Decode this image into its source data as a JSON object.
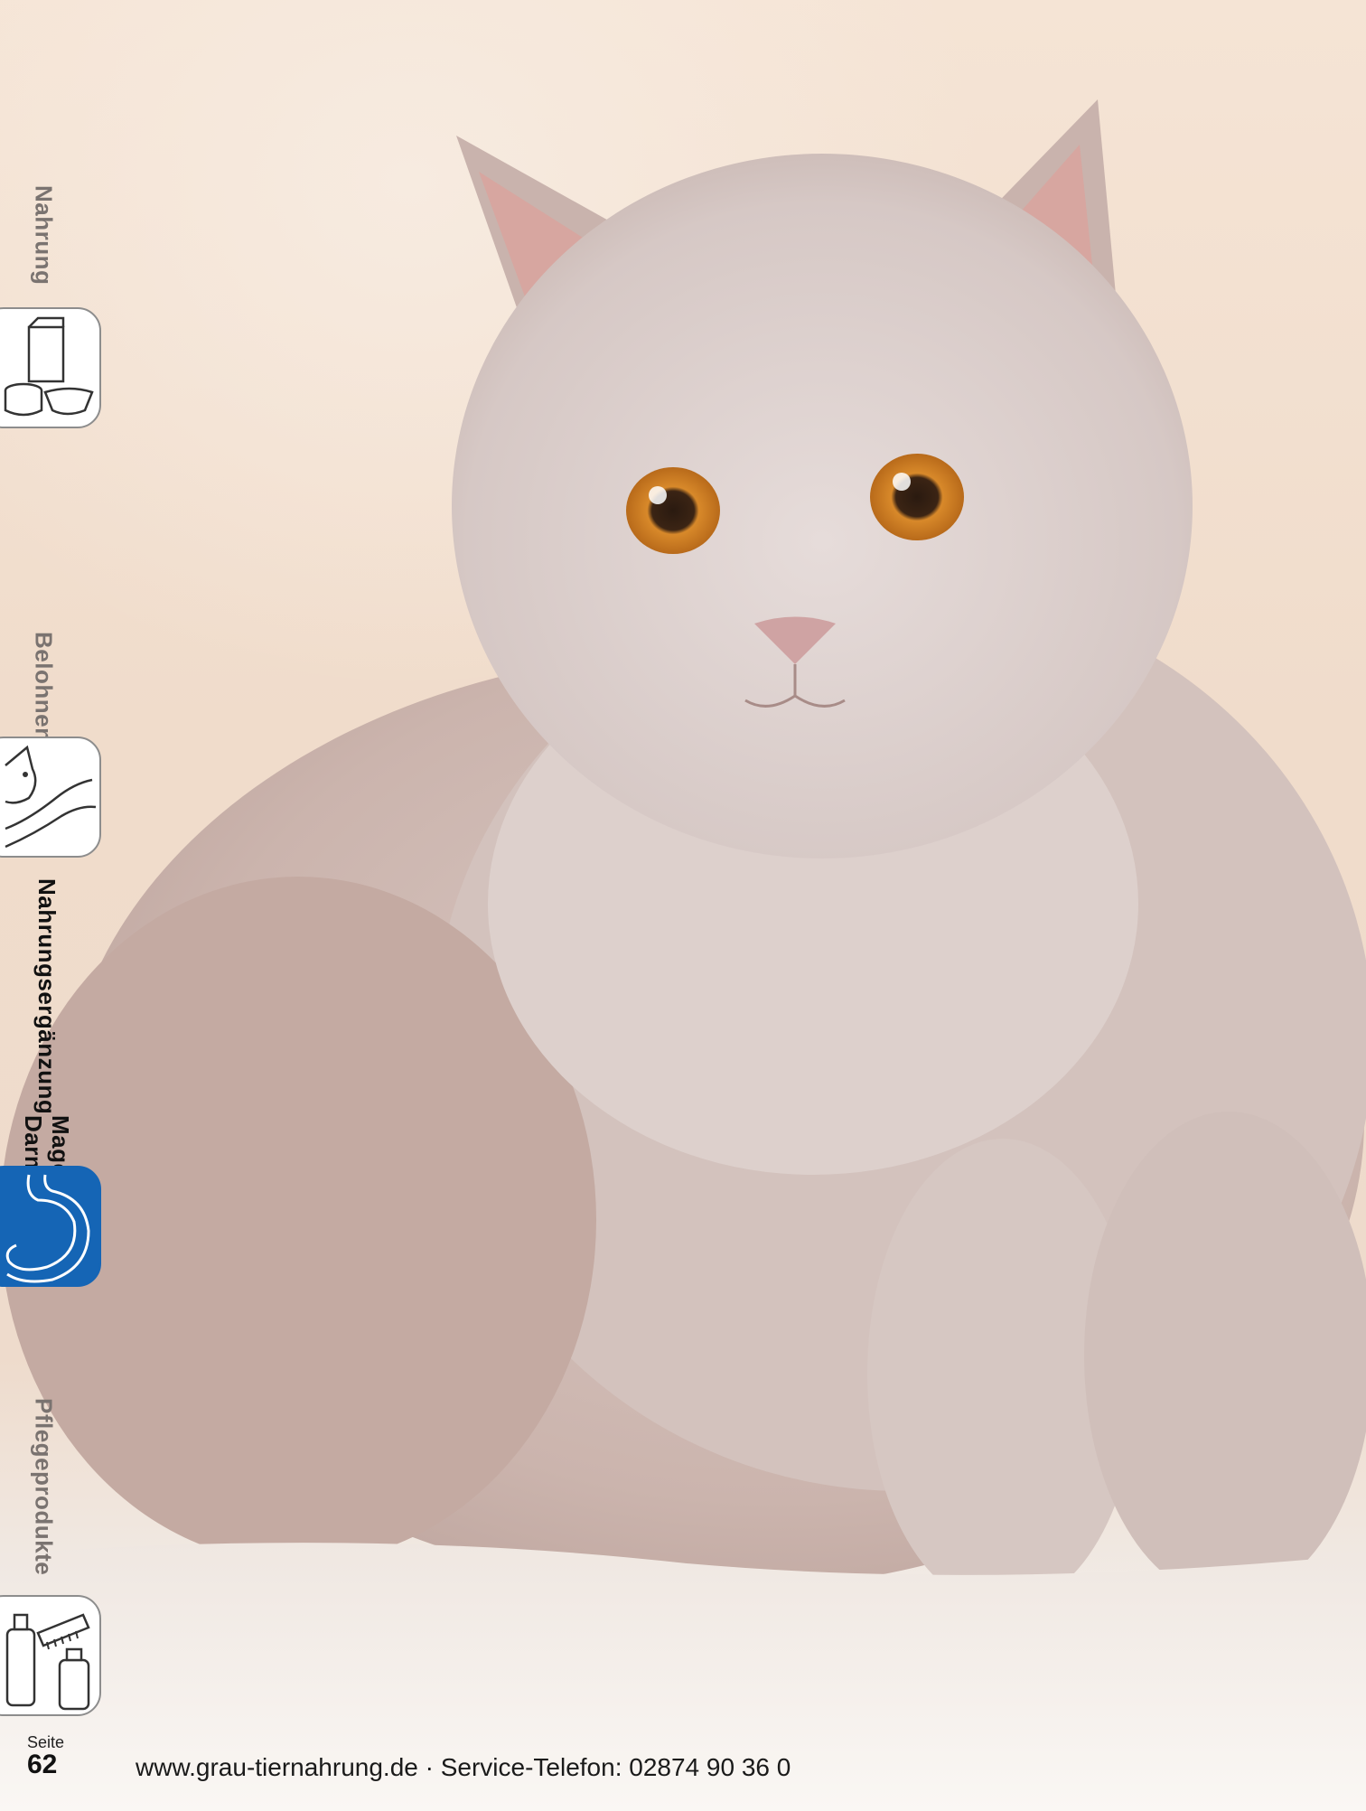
{
  "tabs": [
    {
      "label": "Nahrung",
      "icon": "food-bowl-icon",
      "active": false
    },
    {
      "label": "Belohnen",
      "icon": "cat-hand-icon",
      "active": false
    },
    {
      "label_line1": "Nahrungsergänzung",
      "label_line2": "Magen-Darm",
      "icon": "stomach-icon",
      "active": true
    },
    {
      "label": "Pflegeprodukte",
      "icon": "grooming-products-icon",
      "active": false
    }
  ],
  "colors": {
    "active_tab": "#1565b5",
    "inactive_tab_text": "#7a7370"
  },
  "footer": {
    "seite_label": "Seite",
    "page_number": "62",
    "contact_line": "www.grau-tiernahrung.de · Service-Telefon: 02874 90 36 0"
  }
}
